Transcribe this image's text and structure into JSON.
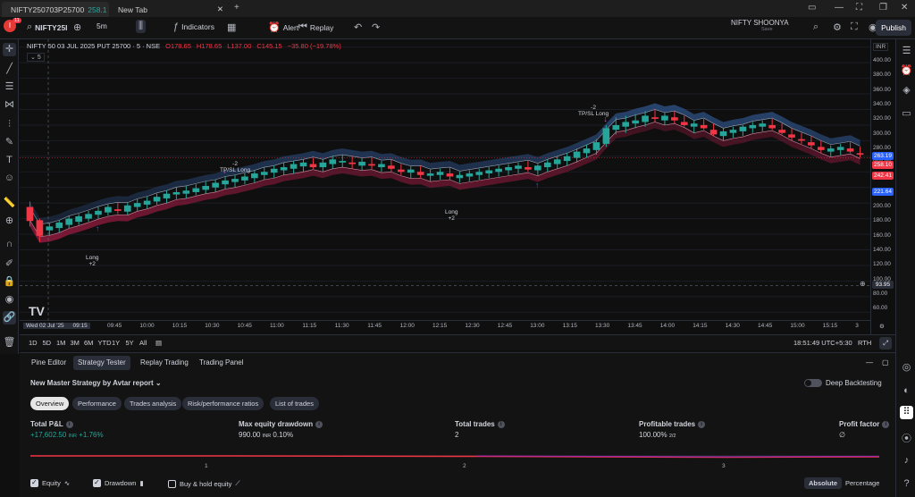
{
  "browser": {
    "tabs": [
      {
        "label": "NIFTY250703P25700",
        "price": "258.1"
      },
      {
        "label": "New Tab"
      }
    ]
  },
  "toolbar": {
    "avatar_badge": "11",
    "symbol": "NIFTY25I",
    "interval": "5m",
    "indicators": "Indicators",
    "alert": "Alert",
    "replay": "Replay",
    "layout_name": "NIFTY SHOONYA",
    "layout_sub": "Save",
    "publish": "Publish"
  },
  "legend": {
    "title": "NIFTY 50 03 JUL 2025 PUT 25700 · 5 · NSE",
    "o": "O178.65",
    "h": "H178.65",
    "l": "L137.00",
    "c": "C145.15",
    "chg": "−35.80 (−19.78%)",
    "interval_box": "5"
  },
  "price_scale": {
    "currency": "INR",
    "labels": [
      "400.00",
      "380.00",
      "360.00",
      "340.00",
      "320.00",
      "300.00",
      "280.00",
      "260.00",
      "240.00",
      "220.00",
      "200.00",
      "180.00",
      "160.00",
      "140.00",
      "120.00",
      "100.00",
      "80.00",
      "60.00"
    ],
    "tags": [
      {
        "value": "263.19",
        "color": "#2962ff"
      },
      {
        "value": "258.10",
        "color": "#f23645"
      },
      {
        "value": "242.41",
        "color": "#f23645"
      },
      {
        "value": "221.64",
        "color": "#2962ff"
      }
    ],
    "crosshair": "93.95"
  },
  "time_axis": {
    "date": "Wed 02 Jul '25",
    "time": "09:15",
    "labels": [
      "09:45",
      "10:00",
      "10:15",
      "10:30",
      "10:45",
      "11:00",
      "11:15",
      "11:30",
      "11:45",
      "12:00",
      "12:15",
      "12:30",
      "12:45",
      "13:00",
      "13:15",
      "13:30",
      "13:45",
      "14:00",
      "14:15",
      "14:30",
      "14:45",
      "15:00",
      "15:15",
      "3"
    ]
  },
  "signals": [
    {
      "text": "Long",
      "qty": "+2"
    },
    {
      "text": "-2",
      "sub": "TP/SL Long"
    },
    {
      "text": "Long",
      "qty": "+2"
    },
    {
      "text": "-2",
      "sub": "TP/SL Long"
    }
  ],
  "range": {
    "buttons": [
      "1D",
      "5D",
      "1M",
      "3M",
      "6M",
      "YTD",
      "1Y",
      "5Y",
      "All"
    ],
    "clock": "18:51:49 UTC+5:30",
    "session": "RTH"
  },
  "panel": {
    "tabs": [
      "Pine Editor",
      "Strategy Tester",
      "Replay Trading",
      "Trading Panel"
    ],
    "report": "New Master Strategy by Avtar report",
    "deep": "Deep Backtesting",
    "chips": [
      "Overview",
      "Performance",
      "Trades analysis",
      "Risk/performance ratios",
      "List of trades"
    ],
    "metrics": [
      {
        "label": "Total P&L",
        "value": "+17,602.50",
        "unit": "INR",
        "pct": "+1.76%"
      },
      {
        "label": "Max equity drawdown",
        "value": "990.00",
        "unit": "INR",
        "pct": "0.10%"
      },
      {
        "label": "Total trades",
        "value": "2"
      },
      {
        "label": "Profitable trades",
        "value": "100.00%",
        "pct": "2/2"
      },
      {
        "label": "Profit factor",
        "value": "∅"
      }
    ],
    "equity_x": [
      "1",
      "2",
      "3"
    ],
    "checks": [
      {
        "label": "Equity",
        "checked": true
      },
      {
        "label": "Drawdown",
        "checked": true
      },
      {
        "label": "Buy & hold equity",
        "checked": false
      }
    ],
    "modes": [
      "Absolute",
      "Percentage"
    ]
  },
  "chart_data": {
    "type": "candlestick",
    "candles": [
      [
        195,
        202,
        170,
        177
      ],
      [
        178,
        180,
        150,
        158
      ],
      [
        165,
        175,
        158,
        170
      ],
      [
        168,
        178,
        162,
        175
      ],
      [
        172,
        183,
        168,
        180
      ],
      [
        176,
        186,
        172,
        183
      ],
      [
        180,
        190,
        176,
        186
      ],
      [
        185,
        195,
        180,
        190
      ],
      [
        188,
        198,
        184,
        195
      ],
      [
        192,
        200,
        186,
        190
      ],
      [
        189,
        200,
        185,
        197
      ],
      [
        195,
        205,
        190,
        200
      ],
      [
        198,
        208,
        193,
        203
      ],
      [
        202,
        212,
        198,
        208
      ],
      [
        206,
        216,
        200,
        212
      ],
      [
        211,
        220,
        205,
        214
      ],
      [
        212,
        222,
        206,
        216
      ],
      [
        214,
        224,
        210,
        219
      ],
      [
        217,
        228,
        212,
        222
      ],
      [
        220,
        230,
        214,
        226
      ],
      [
        224,
        234,
        218,
        229
      ],
      [
        227,
        236,
        220,
        231
      ],
      [
        229,
        238,
        224,
        234
      ],
      [
        232,
        242,
        226,
        238
      ],
      [
        236,
        246,
        230,
        240
      ],
      [
        239,
        248,
        232,
        244
      ],
      [
        242,
        252,
        236,
        246
      ],
      [
        244,
        254,
        238,
        250
      ],
      [
        247,
        256,
        240,
        252
      ],
      [
        250,
        258,
        244,
        246
      ],
      [
        246,
        256,
        240,
        252
      ],
      [
        250,
        260,
        244,
        256
      ],
      [
        252,
        262,
        246,
        254
      ],
      [
        252,
        260,
        244,
        250
      ],
      [
        248,
        258,
        242,
        253
      ],
      [
        250,
        258,
        244,
        248
      ],
      [
        246,
        254,
        240,
        250
      ],
      [
        248,
        256,
        240,
        244
      ],
      [
        243,
        250,
        236,
        240
      ],
      [
        239,
        247,
        232,
        243
      ],
      [
        240,
        248,
        232,
        236
      ],
      [
        235,
        243,
        228,
        238
      ],
      [
        236,
        244,
        230,
        240
      ],
      [
        238,
        246,
        230,
        234
      ],
      [
        232,
        240,
        226,
        236
      ],
      [
        234,
        242,
        228,
        238
      ],
      [
        236,
        244,
        230,
        240
      ],
      [
        238,
        246,
        232,
        242
      ],
      [
        240,
        248,
        234,
        244
      ],
      [
        242,
        250,
        236,
        246
      ],
      [
        244,
        252,
        238,
        248
      ],
      [
        246,
        254,
        240,
        243
      ],
      [
        242,
        250,
        236,
        248
      ],
      [
        246,
        256,
        240,
        252
      ],
      [
        250,
        260,
        244,
        256
      ],
      [
        254,
        264,
        248,
        260
      ],
      [
        258,
        270,
        252,
        266
      ],
      [
        264,
        275,
        258,
        270
      ],
      [
        268,
        282,
        262,
        278
      ],
      [
        276,
        300,
        272,
        296
      ],
      [
        294,
        310,
        288,
        300
      ],
      [
        298,
        312,
        290,
        304
      ],
      [
        302,
        314,
        296,
        306
      ],
      [
        304,
        318,
        298,
        312
      ],
      [
        310,
        320,
        304,
        308
      ],
      [
        306,
        316,
        300,
        312
      ],
      [
        310,
        318,
        302,
        306
      ],
      [
        304,
        312,
        298,
        300
      ],
      [
        298,
        306,
        290,
        302
      ],
      [
        300,
        308,
        294,
        296
      ],
      [
        294,
        302,
        286,
        288
      ],
      [
        286,
        296,
        280,
        292
      ],
      [
        290,
        298,
        284,
        294
      ],
      [
        292,
        300,
        286,
        298
      ],
      [
        296,
        304,
        290,
        300
      ],
      [
        298,
        306,
        292,
        302
      ],
      [
        300,
        308,
        294,
        296
      ],
      [
        294,
        302,
        288,
        290
      ],
      [
        288,
        296,
        280,
        284
      ],
      [
        282,
        290,
        276,
        280
      ],
      [
        278,
        286,
        270,
        274
      ],
      [
        272,
        280,
        264,
        268
      ],
      [
        266,
        274,
        260,
        270
      ],
      [
        268,
        276,
        262,
        272
      ],
      [
        270,
        278,
        264,
        266
      ],
      [
        264,
        272,
        258,
        262
      ]
    ],
    "ylim": [
      50,
      410
    ]
  }
}
